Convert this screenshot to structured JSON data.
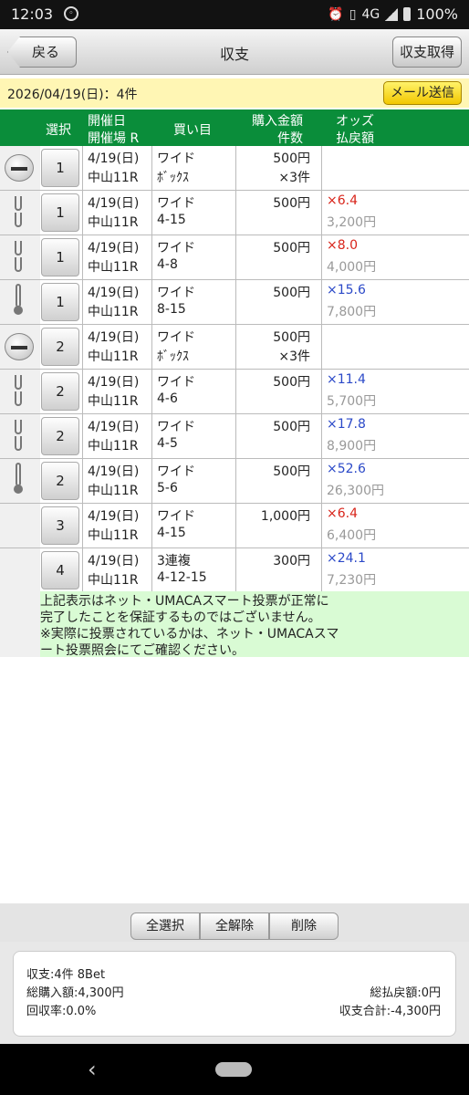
{
  "status": {
    "time": "12:03",
    "network": "4G",
    "battery": "100%"
  },
  "header": {
    "back_label": "戻る",
    "title": "収支",
    "fetch_label": "収支取得"
  },
  "info": {
    "summary_line": "2026/04/19(日)：4件",
    "mail_label": "メール送信"
  },
  "table": {
    "headers": {
      "select": "選択",
      "date": "開催日",
      "venue": "開催場 R",
      "bet": "買い目",
      "amount": "購入金額",
      "count": "件数",
      "odds": "オッズ",
      "payout": "払戻額"
    },
    "rows": [
      {
        "icon": "minus",
        "select": "1",
        "date": "4/19(日)",
        "place": "中山11R",
        "type": "ワイド",
        "combo": "ﾎﾞｯｸｽ",
        "amount": "500円",
        "count": "×3件",
        "odds": "",
        "odds_color": "",
        "payout": ""
      },
      {
        "icon": "link",
        "select": "1",
        "date": "4/19(日)",
        "place": "中山11R",
        "type": "ワイド",
        "combo": "4-15",
        "amount": "500円",
        "count": "",
        "odds": "×6.4",
        "odds_color": "red",
        "payout": "3,200円"
      },
      {
        "icon": "link",
        "select": "1",
        "date": "4/19(日)",
        "place": "中山11R",
        "type": "ワイド",
        "combo": "4-8",
        "amount": "500円",
        "count": "",
        "odds": "×8.0",
        "odds_color": "red",
        "payout": "4,000円"
      },
      {
        "icon": "end",
        "select": "1",
        "date": "4/19(日)",
        "place": "中山11R",
        "type": "ワイド",
        "combo": "8-15",
        "amount": "500円",
        "count": "",
        "odds": "×15.6",
        "odds_color": "blue",
        "payout": "7,800円"
      },
      {
        "icon": "minus",
        "select": "2",
        "date": "4/19(日)",
        "place": "中山11R",
        "type": "ワイド",
        "combo": "ﾎﾞｯｸｽ",
        "amount": "500円",
        "count": "×3件",
        "odds": "",
        "odds_color": "",
        "payout": ""
      },
      {
        "icon": "link",
        "select": "2",
        "date": "4/19(日)",
        "place": "中山11R",
        "type": "ワイド",
        "combo": "4-6",
        "amount": "500円",
        "count": "",
        "odds": "×11.4",
        "odds_color": "blue",
        "payout": "5,700円"
      },
      {
        "icon": "link",
        "select": "2",
        "date": "4/19(日)",
        "place": "中山11R",
        "type": "ワイド",
        "combo": "4-5",
        "amount": "500円",
        "count": "",
        "odds": "×17.8",
        "odds_color": "blue",
        "payout": "8,900円"
      },
      {
        "icon": "end",
        "select": "2",
        "date": "4/19(日)",
        "place": "中山11R",
        "type": "ワイド",
        "combo": "5-6",
        "amount": "500円",
        "count": "",
        "odds": "×52.6",
        "odds_color": "blue",
        "payout": "26,300円"
      },
      {
        "icon": "none",
        "select": "3",
        "date": "4/19(日)",
        "place": "中山11R",
        "type": "ワイド",
        "combo": "4-15",
        "amount": "1,000円",
        "count": "",
        "odds": "×6.4",
        "odds_color": "red",
        "payout": "6,400円"
      },
      {
        "icon": "none",
        "select": "4",
        "date": "4/19(日)",
        "place": "中山11R",
        "type": "3連複",
        "combo": "4-12-15",
        "amount": "300円",
        "count": "",
        "odds": "×24.1",
        "odds_color": "blue",
        "payout": "7,230円"
      }
    ]
  },
  "notice": {
    "line1": "上記表示はネット・UMACAスマート投票が正常に",
    "line2": "完了したことを保証するものではございません。",
    "line3": "※実際に投票されているかは、ネット・UMACAスマ",
    "line4": "ート投票照会にてご確認ください。"
  },
  "actions": {
    "select_all": "全選択",
    "deselect_all": "全解除",
    "delete": "削除"
  },
  "summary": {
    "count_line": "収支:4件 8Bet",
    "total_purchase": "総購入額:4,300円",
    "total_payout": "総払戻額:0円",
    "recovery_rate": "回収率:0.0%",
    "balance": "収支合計:-4,300円"
  },
  "colors": {
    "header_green": "#0a8d3a",
    "odds_red": "#d8241a",
    "odds_blue": "#2b49c8",
    "notice_bg": "#d9fbd4",
    "info_bg": "#fff6b4"
  }
}
